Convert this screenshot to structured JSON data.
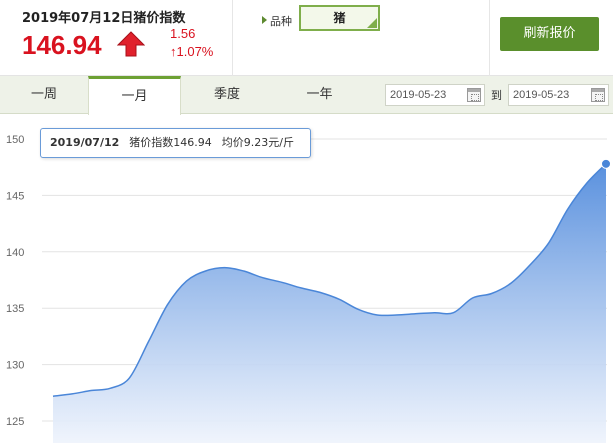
{
  "header": {
    "title": "2019年07月12日猪价指数",
    "price": "146.94",
    "change": "1.56",
    "change_pct": "↑1.07%",
    "variety_label": "品种",
    "variety_value": "猪",
    "refresh_label": "刷新报价",
    "accent_up": "#d9121f"
  },
  "tabs": [
    {
      "label": "一周"
    },
    {
      "label": "一月",
      "active": true
    },
    {
      "label": "季度"
    },
    {
      "label": "一年"
    }
  ],
  "date_range": {
    "start": "2019-05-23",
    "to_label": "到",
    "end": "2019-05-23"
  },
  "tooltip": {
    "date": "2019/07/12",
    "index_text": "猪价指数146.94",
    "avg_text": "均价9.23元/斤"
  },
  "chart_data": {
    "type": "area",
    "title": "",
    "xlabel": "",
    "ylabel": "",
    "ylim": [
      125,
      150
    ],
    "yticks": [
      125,
      130,
      135,
      140,
      145,
      150
    ],
    "grid": true,
    "series": [
      {
        "values": [
          127.2,
          127.4,
          127.7,
          127.9,
          128.8,
          132.0,
          135.3,
          137.4,
          138.3,
          138.6,
          138.3,
          137.7,
          137.3,
          136.8,
          136.4,
          135.8,
          134.9,
          134.4,
          134.4,
          134.5,
          134.6,
          134.6,
          135.9,
          136.3,
          137.2,
          138.8,
          140.8,
          143.8,
          146.1,
          147.8
        ]
      }
    ],
    "line_color": "#4a86d8",
    "fill_top": "#5a91de",
    "fill_bottom": "#eef3fc"
  }
}
